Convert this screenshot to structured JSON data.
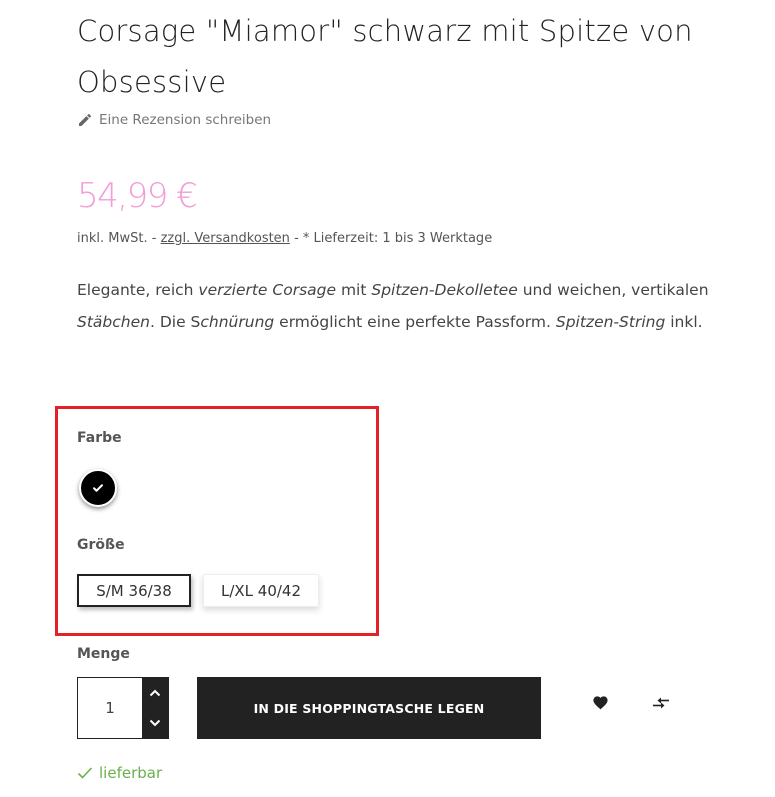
{
  "product": {
    "title": "Corsage \"Miamor\" schwarz mit Spitze von Obsessive",
    "review_link": "Eine Rezension schreiben",
    "price": "54,99 €",
    "tax_prefix": "inkl. MwSt. -",
    "shipping_link": "zzgl. Versandkosten",
    "tax_suffix": "- * Lieferzeit: 1 bis 3 Werktage",
    "description": {
      "p1": "Elegante, reich ",
      "e1": "verzierte Corsage",
      "p2": " mit ",
      "e2": "Spitzen-Dekolletee",
      "p3": " und weichen, vertikalen ",
      "e3": "Stäbchen",
      "p4": ". Die S",
      "e4": "chnürung",
      "p5": " ermöglicht eine perfekte Passform. ",
      "e5": "Spitzen-String",
      "p6": " inkl."
    }
  },
  "options": {
    "color_label": "Farbe",
    "color_value": "#000000",
    "size_label": "Größe",
    "sizes": [
      "S/M 36/38",
      "L/XL 40/42"
    ],
    "selected_size": "S/M 36/38"
  },
  "purchase": {
    "quantity_label": "Menge",
    "quantity": "1",
    "add_to_cart": "IN DIE SHOPPINGTASCHE LEGEN",
    "availability": "lieferbar"
  },
  "colors": {
    "price": "#f29dd5",
    "highlight": "#e32228",
    "available": "#6ab04c",
    "button": "#222222"
  }
}
